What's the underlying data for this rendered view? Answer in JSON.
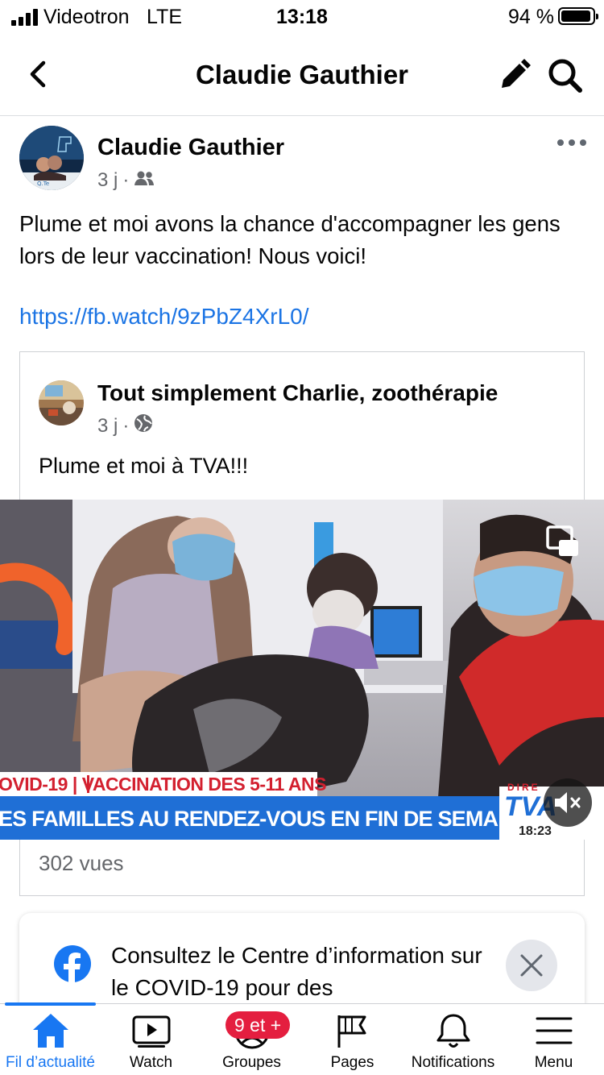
{
  "status_bar": {
    "carrier": "Videotron",
    "network": "LTE",
    "time": "13:18",
    "battery": "94 %",
    "battery_level": 0.94
  },
  "header": {
    "title": "Claudie Gauthier",
    "back_icon": "chevron-left-icon",
    "edit_icon": "pencil-icon",
    "search_icon": "search-icon"
  },
  "post": {
    "author": "Claudie Gauthier",
    "time": "3 j",
    "audience_icon": "friends-icon",
    "text": "Plume et moi avons la chance d'accompagner les gens lors de leur vaccination! Nous voici!",
    "link": "https://fb.watch/9zPbZ4XrL0/",
    "shared": {
      "author": "Tout simplement Charlie, zoothérapie",
      "time": "3 j",
      "audience_icon": "globe-icon",
      "text": "Plume et moi à TVA!!!",
      "video": {
        "banner_top": "OVID-19 | VACCINATION DES 5-11 ANS",
        "banner_bottom": "ES FAMILLES AU RENDEZ-VOUS EN FIN DE SEMAINE",
        "channel": "TVA",
        "live_tag": "DIRE",
        "clock": "18:23"
      },
      "views": "302 vues"
    }
  },
  "covid_card": {
    "text": "Consultez le Centre d’information sur le COVID-19 pour des"
  },
  "tabbar": {
    "tabs": [
      {
        "label": "Fil d’actualité",
        "icon": "home-icon"
      },
      {
        "label": "Watch",
        "icon": "watch-icon"
      },
      {
        "label": "Groupes",
        "icon": "groups-icon"
      },
      {
        "label": "Pages",
        "icon": "flag-icon"
      },
      {
        "label": "Notifications",
        "icon": "bell-icon"
      },
      {
        "label": "Menu",
        "icon": "menu-icon"
      }
    ],
    "groups_badge": "9 et +"
  },
  "colors": {
    "accent": "#1877f2",
    "link": "#1b74e4",
    "badge": "#e41e3f",
    "secondary_text": "#65676b"
  }
}
